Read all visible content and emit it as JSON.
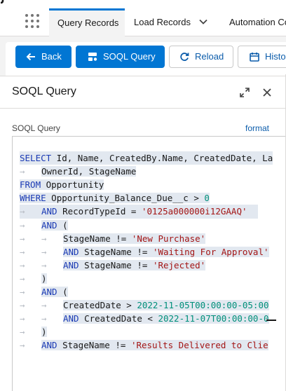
{
  "nav": {
    "tabs": [
      {
        "label": "Query Records",
        "active": true
      },
      {
        "label": "Load Records",
        "active": false
      },
      {
        "label": "Automation Co",
        "active": false
      }
    ]
  },
  "toolbar": {
    "back_label": "Back",
    "soql_label": "SOQL Query",
    "reload_label": "Reload",
    "history_label": "Histo"
  },
  "panel": {
    "title": "SOQL Query",
    "field_label": "SOQL Query",
    "format_label": "format"
  },
  "colors": {
    "brand": "#0176d3",
    "link": "#0b5cab",
    "keyword": "#1a3ab4",
    "string": "#a31515",
    "number": "#008f7a",
    "selection": "#e2e8f0"
  },
  "query": {
    "l1a": "SELECT",
    "l1b": " Id, Name, CreatedBy.Name, CreatedDate, La",
    "l2": "OwnerId, StageName",
    "l3a": "FROM",
    "l3b": " Opportunity",
    "l4a": "WHERE",
    "l4b": " Opportunity_Balance_Due__c > ",
    "l4c": "0",
    "l5a": "AND",
    "l5b": " RecordTypeId = ",
    "l5c": "'0125a000000i12GAAQ'",
    "l6a": "AND",
    "l6b": " (",
    "l7a": "StageName != ",
    "l7b": "'New Purchase'",
    "l8a": "AND",
    "l8b": " StageName != ",
    "l8c": "'Waiting For Approval'",
    "l9a": "AND",
    "l9b": " StageName != ",
    "l9c": "'Rejected'",
    "l10": ")",
    "l11a": "AND",
    "l11b": " (",
    "l12a": "CreatedDate > ",
    "l12b": "2022-11-05T00:00:00-05:00",
    "l13a": "AND",
    "l13b": " CreatedDate < ",
    "l13c": "2022-11-07T00:00:00-0",
    "l14": ")",
    "l15a": "AND",
    "l15b": " StageName != ",
    "l15c": "'Results Delivered to Clie",
    "tab_glyph": "→"
  }
}
